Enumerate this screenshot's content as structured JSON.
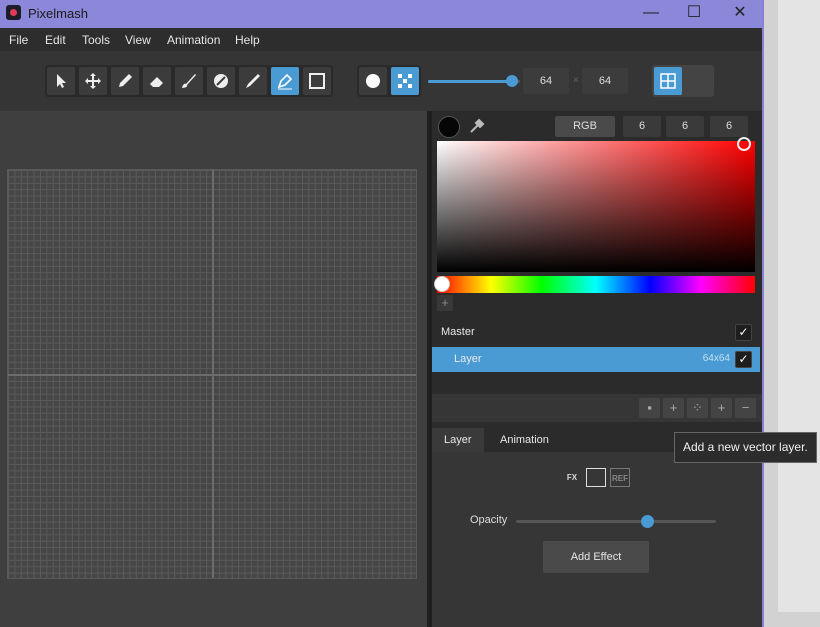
{
  "window": {
    "title": "Pixelmash",
    "minimize_glyph": "—",
    "maximize_glyph": "☐",
    "close_glyph": "✕"
  },
  "menu": [
    "File",
    "Edit",
    "Tools",
    "View",
    "Animation",
    "Help"
  ],
  "toolbar": {
    "tools": [
      "select-icon",
      "move-icon",
      "pencil-icon",
      "eraser-icon",
      "brush-icon",
      "fill-icon",
      "paint-icon",
      "pen-icon",
      "rectangle-icon"
    ],
    "active_tool": "pen-icon",
    "brush_shapes": [
      "circle-brush-icon",
      "dither-brush-icon"
    ],
    "canvas_width": "64",
    "canvas_height": "64",
    "size_separator": "×",
    "size_slider_value": 0.9
  },
  "color": {
    "mode_label": "RGB",
    "r": "6",
    "g": "6",
    "b": "6",
    "add_swatch_glyph": "+"
  },
  "layers": {
    "master_label": "Master",
    "layer_label": "Layer",
    "layer_size": "64x64",
    "check_glyph": "✓"
  },
  "layer_tools": [
    "duplicate-icon",
    "add-layer-icon",
    "add-vector-layer-icon",
    "plus-icon",
    "minus-icon"
  ],
  "tabs": {
    "layer": "Layer",
    "animation": "Animation"
  },
  "effects": {
    "fx_label": "FX",
    "ref_label": "REF",
    "opacity_label": "Opacity",
    "opacity_value": 0.66,
    "add_effect_label": "Add Effect"
  },
  "tooltip": {
    "text": "Add a new vector layer."
  },
  "colors": {
    "accent": "#4a9ad4",
    "titlebar": "#8b87d9",
    "background": "#2b2b2b"
  }
}
